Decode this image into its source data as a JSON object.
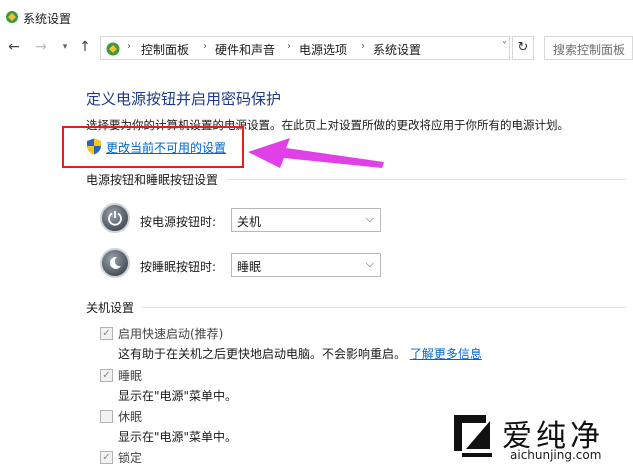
{
  "window": {
    "title": "系统设置"
  },
  "nav": {
    "back_icon": "arrow-left-icon",
    "forward_icon": "arrow-right-icon",
    "recent_icon": "chevron-down-icon",
    "up_icon": "arrow-up-icon"
  },
  "address": {
    "crumbs": [
      "控制面板",
      "硬件和声音",
      "电源选项",
      "系统设置"
    ]
  },
  "search": {
    "placeholder": "搜索控制面板"
  },
  "page": {
    "heading": "定义电源按钮并启用密码保护",
    "intro": "选择要为你的计算机设置的电源设置。在此页上对设置所做的更改将应用于你所有的电源计划。",
    "change_link": "更改当前不可用的设置"
  },
  "power_section": {
    "title": "电源按钮和睡眠按钮设置",
    "rows": [
      {
        "label": "按电源按钮时:",
        "value": "关机"
      },
      {
        "label": "按睡眠按钮时:",
        "value": "睡眠"
      }
    ]
  },
  "shutdown_section": {
    "title": "关机设置",
    "items": [
      {
        "label": "启用快速启动(推荐)",
        "checked": true,
        "desc": "这有助于在关机之后更快地启动电脑。不会影响重启。",
        "link": "了解更多信息"
      },
      {
        "label": "睡眠",
        "checked": true,
        "desc": "显示在\"电源\"菜单中。"
      },
      {
        "label": "休眠",
        "checked": false,
        "desc": "显示在\"电源\"菜单中。"
      },
      {
        "label": "锁定",
        "checked": true
      }
    ]
  },
  "watermark": {
    "text": "爱纯净",
    "url": "aichunjing.com"
  },
  "colors": {
    "accent": "#1e3a8a",
    "link": "#0066cc",
    "highlight_box": "#e0201f",
    "arrow": "#e040e8"
  }
}
